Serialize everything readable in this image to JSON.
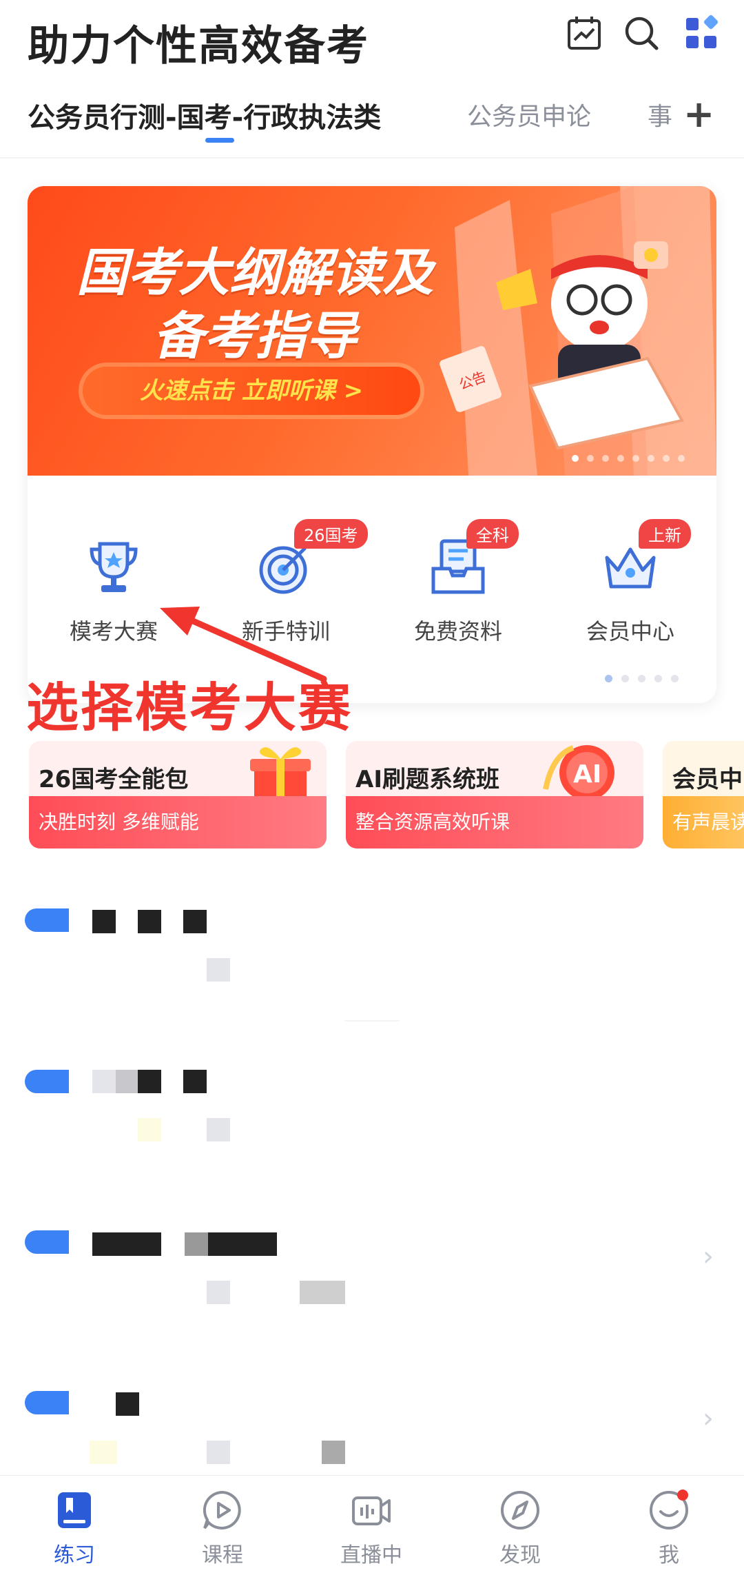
{
  "header": {
    "title": "助力个性高效备考",
    "icons": [
      "calendar-chart-icon",
      "search-icon",
      "apps-grid-icon"
    ]
  },
  "tabs": {
    "active": "公务员行测-国考-行政执法类",
    "items": [
      "公务员申论",
      "事"
    ]
  },
  "banner": {
    "title_line1": "国考大纲解读及",
    "title_line2": "备考指导",
    "cta": "火速点击 立即听课 >",
    "tag": "公告"
  },
  "features": [
    {
      "label": "模考大赛",
      "icon": "trophy-icon",
      "badge": ""
    },
    {
      "label": "新手特训",
      "icon": "target-icon",
      "badge": "26国考"
    },
    {
      "label": "免费资料",
      "icon": "document-tray-icon",
      "badge": "全科"
    },
    {
      "label": "会员中心",
      "icon": "crown-icon",
      "badge": "上新"
    }
  ],
  "annotation": "选择模考大赛",
  "promos": [
    {
      "title": "26国考全能包",
      "subtitle": "决胜时刻 多维赋能"
    },
    {
      "title": "AI刷题系统班",
      "subtitle": "整合资源高效听课"
    },
    {
      "title": "会员中",
      "subtitle": "有声晨读"
    }
  ],
  "nav": [
    {
      "label": "练习",
      "icon": "book-icon"
    },
    {
      "label": "课程",
      "icon": "play-bubble-icon"
    },
    {
      "label": "直播中",
      "icon": "live-video-icon"
    },
    {
      "label": "发现",
      "icon": "compass-icon"
    },
    {
      "label": "我",
      "icon": "profile-icon"
    }
  ],
  "colors": {
    "accent": "#3b82f6",
    "annotation": "#f0352f",
    "banner": "#ff5a22",
    "badge": "#f04545"
  }
}
